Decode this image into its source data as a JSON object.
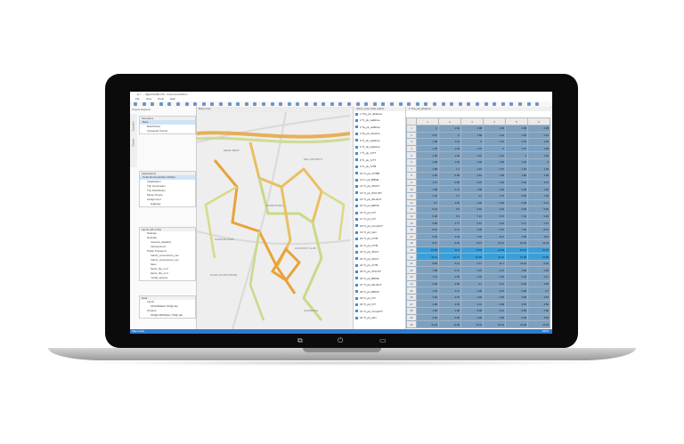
{
  "app": {
    "title": "C:\\... - OpenPaths 2.00 - Advanced Edition",
    "menu": [
      "File",
      "View",
      "Tools",
      "Help"
    ],
    "window_buttons": "– ▢ ✕",
    "status": "Map ready"
  },
  "left_panel": {
    "title": "Project Explorer",
    "side_tabs": [
      "Scenarios",
      "Reports"
    ],
    "scenarios": {
      "header": "Scenarios",
      "items": [
        "Base",
        "Build Road",
        "Increased Transit"
      ],
      "selected": 0
    },
    "applications": {
      "header": "Applications",
      "items": [
        "Cube Demonstration Model",
        "Initialization",
        "Trip Generation",
        "Trip Distribution",
        "Mode Choice",
        "Assignment",
        "Highway"
      ],
      "selected": 0
    },
    "inputs": {
      "header": "Inputs (25 of 40)",
      "items": [
        "Settings",
        "Network",
        "network_detailed",
        "Intersections",
        "Public Transport",
        "transit_connections_set",
        "transit_connections_set",
        "fares",
        "factor_file_ncrl",
        "factor_file_ncrl",
        "model_access"
      ]
    },
    "data": {
      "header": "Data",
      "items": [
        "Inputs",
        "OD/AdMaker ND@.dat",
        "Outputs",
        "OD@LdM/Maker OD@.dat"
      ]
    }
  },
  "map": {
    "tab": "Base.map",
    "labels": [
      "EDGE WEST",
      "DOWNTOWN",
      "MILL DISTRICT",
      "SUNRISE PARK",
      "GLEN COURTHOUSE",
      "COUNTRY CLUB",
      "GLENDALE"
    ]
  },
  "column_list": {
    "tab": "skims_loop.cube.matrix",
    "items": [
      "1 Trip_pk_distance",
      "2 Tt_pk_walltime",
      "3 Ta_pk_walltime",
      "4 Ta_pk_drwtime",
      "5 Tt_pk_walltime",
      "6 Tt_pk_waittime",
      "7 Tt_pk_IVTT",
      "8 Tt_pk_IVTT",
      "9 Tt_pk_IVTB",
      "10 Tt_pk_IVTBB",
      "11 Tt_pk_BRDE",
      "12 Tt_pk_INVDT",
      "13 Tt_pk_INVLINT",
      "14 Tt_pk_INLGHT",
      "15 Tt_pk_BRDS",
      "16 Tt_pk_IVT",
      "17 Tt_pk_IVT",
      "18 Tt_pk_CompIVT",
      "19 Tt_pk_pkm",
      "20 Tt_pk_IVTB",
      "21 Tt_pk_IVTB",
      "22 Tt_pk_INVLT",
      "23 Tt_pk_INVLT",
      "24 Tt_pk_IVTB",
      "25 Tt_pk_INVLNT",
      "26 Tt_pk_BRDE",
      "27 Tt_pk_INLGHT",
      "28 Tt_pk_BRDS",
      "29 Tt_pk_IVT",
      "30 Tt_pk_IVT",
      "31 Tt_pk_CompIVT",
      "32 Tt_pk_pkm"
    ]
  },
  "grid": {
    "tab": "1 Trip_pk_distance",
    "columns": [
      "1",
      "2",
      "3",
      "4",
      "5",
      "6"
    ],
    "rows": [
      [
        "1",
        "0",
        "1.94",
        "1.98",
        "1.35",
        "1.68",
        "2.05"
      ],
      [
        "2",
        "0.67",
        "0",
        "1.68",
        "1.44",
        "1.06",
        "1.44"
      ],
      [
        "3",
        "1.98",
        "1.21",
        "0",
        "1.72",
        "1.31",
        "1.46"
      ],
      [
        "4",
        "1.35",
        "1.44",
        "1.72",
        "0",
        "1.57",
        "1.68"
      ],
      [
        "5",
        "1.90",
        "1.06",
        "1.10",
        "1.41",
        "0",
        "1.30"
      ],
      [
        "6",
        "1.68",
        "1.44",
        "1.40",
        "1.48",
        "1.30",
        "0"
      ],
      [
        "7",
        "1.98",
        "1.1",
        "1.16",
        "1.07",
        "1.34",
        "1.53"
      ],
      [
        "8",
        "1.56",
        "0.99",
        "1.61",
        "1.95",
        "1.86",
        "1.28"
      ],
      [
        "9",
        "1.47",
        "0.85",
        "0.97",
        "2.18",
        "2.66",
        "3.16"
      ],
      [
        "10",
        "1.98",
        "2.13",
        "1.68",
        "1.20",
        "3.28",
        "1.26"
      ],
      [
        "11",
        "2.01",
        "4.7",
        "3.2",
        "1.73",
        "3.60",
        "1.29"
      ],
      [
        "12",
        "9.7",
        "4.65",
        "4.46",
        "5.00",
        "5.60",
        "5.10"
      ],
      [
        "13",
        "6.44",
        "6.6",
        "6.63",
        "4.34",
        "6.60",
        "5.69"
      ],
      [
        "14",
        "6.28",
        "9.3",
        "7.21",
        "5.07",
        "7.44",
        "6.25"
      ],
      [
        "15",
        "5.58",
        "4.77",
        "6.57",
        "4.42",
        "2.17",
        "7.37"
      ],
      [
        "16",
        "8.51",
        "6.17",
        "3.35",
        "3.16",
        "7.30",
        "8.47"
      ],
      [
        "17",
        "9.04",
        "4.24",
        "4.18",
        "11.2",
        "4.90",
        "10.9"
      ],
      [
        "18",
        "8.37",
        "9.84",
        "8.47",
        "11.37",
        "10.64",
        "11.24"
      ],
      [
        "19",
        "10.69",
        "11.4",
        "11.83",
        "12.83",
        "12.07",
        "12.37"
      ],
      [
        "20",
        "14.11",
        "12.37",
        "10.66",
        "11.42",
        "13.68",
        "13.35"
      ],
      [
        "21",
        "8.50",
        "5.11",
        "4.17",
        "11.7",
        "11.64",
        "6.40"
      ],
      [
        "22",
        "7.68",
        "2.17",
        "2.15",
        "2.14",
        "2.68",
        "2.25"
      ],
      [
        "23",
        "7.31",
        "2.45",
        "2.33",
        "2.40",
        "2.33",
        "2.17"
      ],
      [
        "24",
        "2.63",
        "3.55",
        "3.7",
        "3.14",
        "5.06",
        "3.05"
      ],
      [
        "25",
        "1.23",
        "4.27",
        "3.36",
        "3.21",
        "4.58",
        "3.7"
      ],
      [
        "26",
        "3.02",
        "4.07",
        "4.05",
        "4.35",
        "3.68",
        "3.87"
      ],
      [
        "27",
        "4.08",
        "3.35",
        "3.11",
        "3.58",
        "4.35",
        "4.50"
      ],
      [
        "28",
        "1.68",
        "1.98",
        "3.08",
        "3.13",
        "3.58",
        "2.80"
      ],
      [
        "29",
        "4.81",
        "6.99",
        "4.39",
        "4.58",
        "6.04",
        "3.69"
      ],
      [
        "30",
        "11.15",
        "11.98",
        "11.04",
        "10.44",
        "11.08",
        "11.35"
      ]
    ],
    "highlight_rows": [
      19,
      20
    ],
    "pager": "1 of 69",
    "zoom": "100%"
  },
  "colors": {
    "accent": "#2e7bd1",
    "cell": "#7da0bf",
    "cell_highlight": "#3a9fd8",
    "road_high": "#e8a33a",
    "road_low": "#c9d98a"
  },
  "hardware": {
    "back_icon": "⧉",
    "power_icon": "⏻",
    "menu_icon": "▭"
  }
}
